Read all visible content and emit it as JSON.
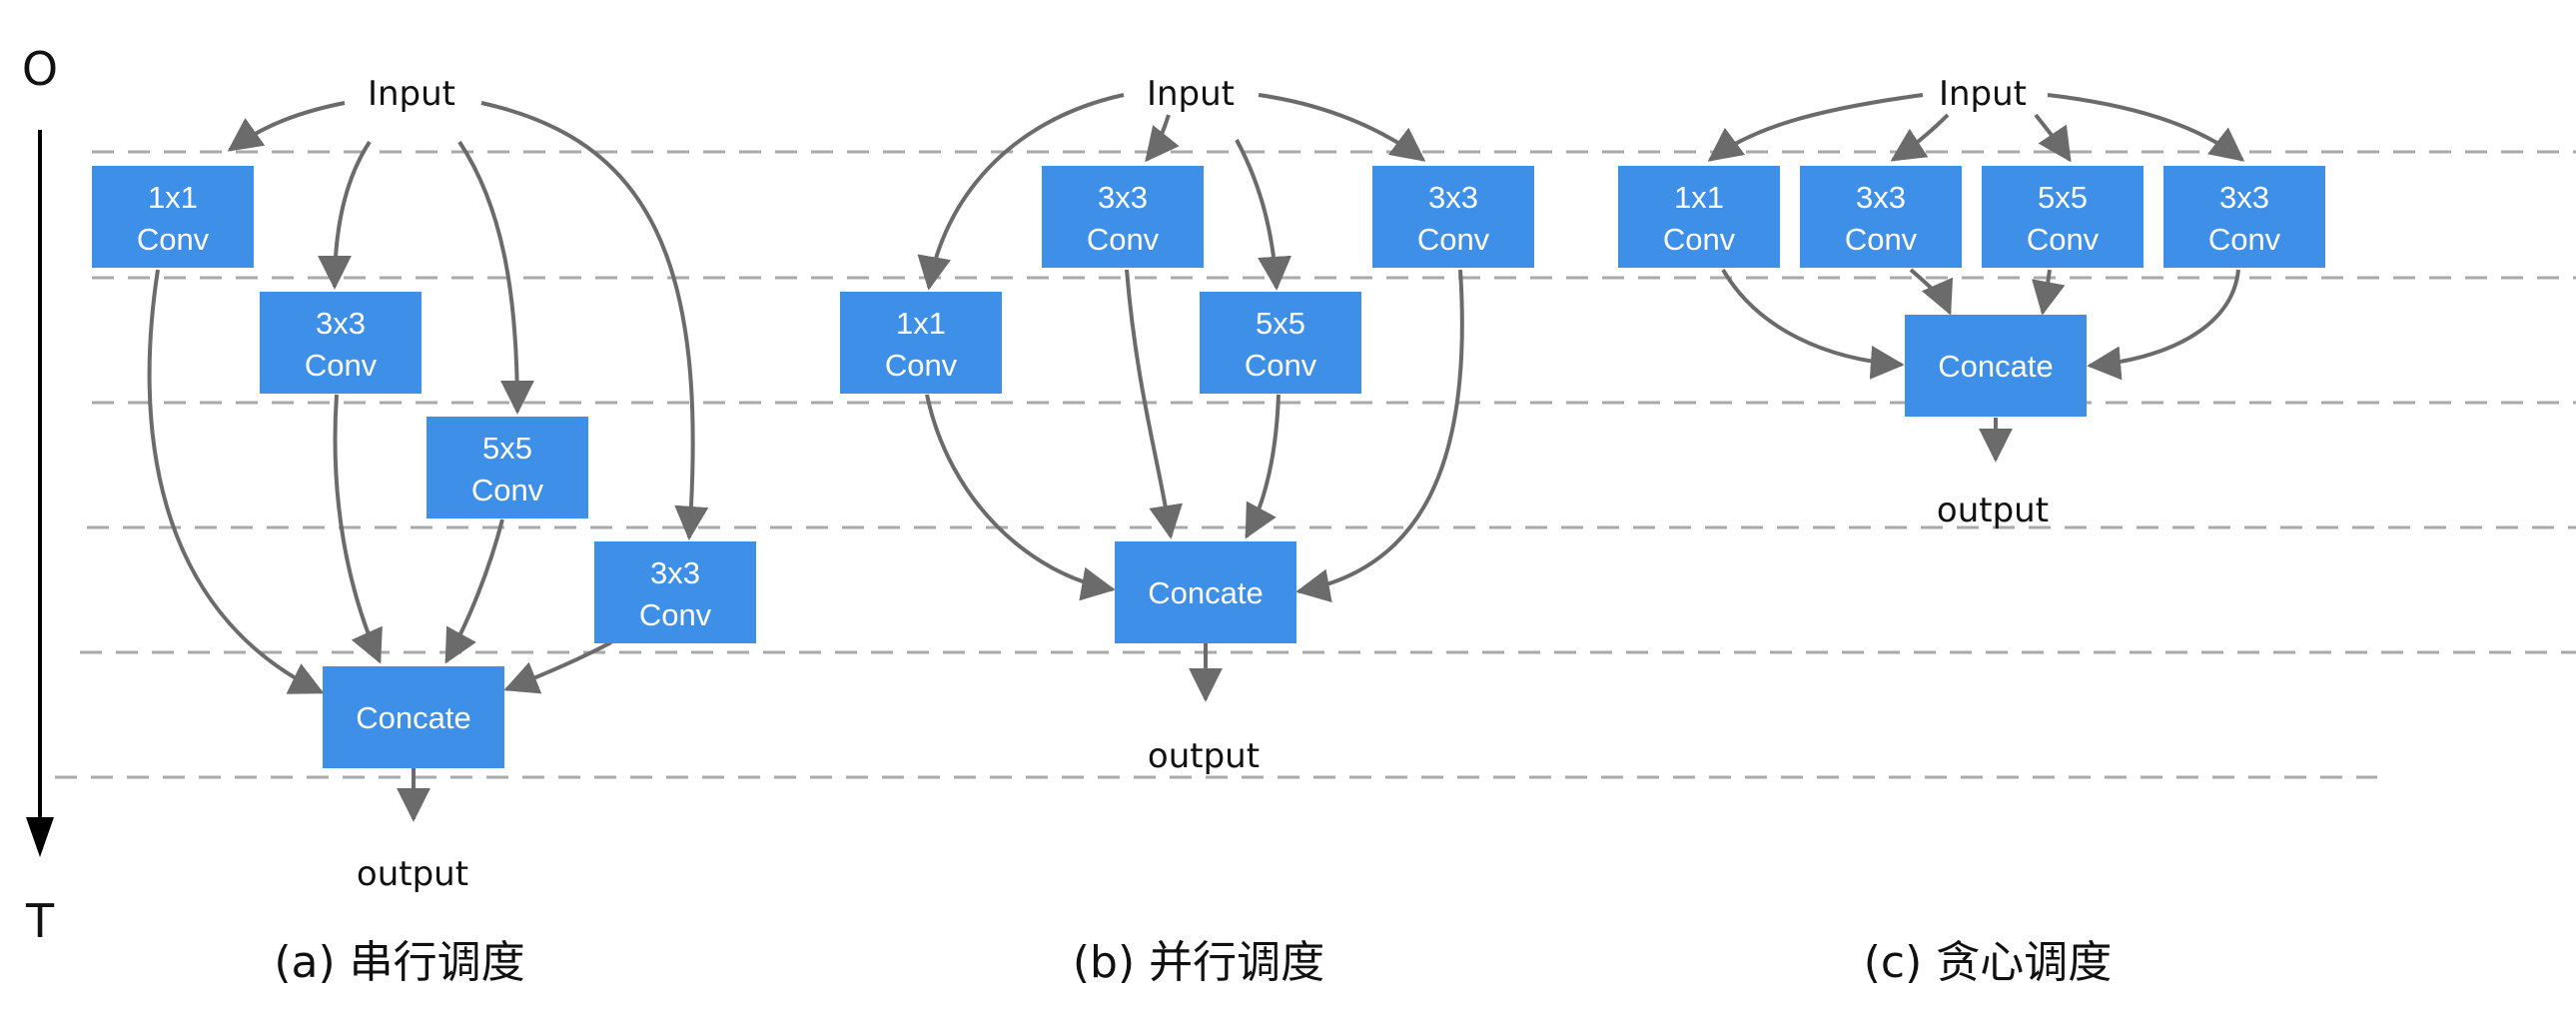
{
  "axis": {
    "start_label": "O",
    "end_label": "T"
  },
  "panels": {
    "a": {
      "input_label": "Input",
      "output_label": "output",
      "caption": "(a) 串行调度",
      "nodes": {
        "c1": [
          "1x1",
          "Conv"
        ],
        "c2": [
          "3x3",
          "Conv"
        ],
        "c3": [
          "5x5",
          "Conv"
        ],
        "c4": [
          "3x3",
          "Conv"
        ],
        "concat": [
          "Concate"
        ]
      }
    },
    "b": {
      "input_label": "Input",
      "output_label": "output",
      "caption": "(b) 并行调度",
      "nodes": {
        "c1": [
          "3x3",
          "Conv"
        ],
        "c2": [
          "3x3",
          "Conv"
        ],
        "c3": [
          "1x1",
          "Conv"
        ],
        "c4": [
          "5x5",
          "Conv"
        ],
        "concat": [
          "Concate"
        ]
      }
    },
    "c": {
      "input_label": "Input",
      "output_label": "output",
      "caption": "(c) 贪心调度",
      "nodes": {
        "c1": [
          "1x1",
          "Conv"
        ],
        "c2": [
          "3x3",
          "Conv"
        ],
        "c3": [
          "5x5",
          "Conv"
        ],
        "c4": [
          "3x3",
          "Conv"
        ],
        "concat": [
          "Concate"
        ]
      }
    }
  },
  "colors": {
    "node_fill": "#3d8fe8",
    "edge": "#6b6b6b",
    "dash": "#a9a9a9"
  }
}
